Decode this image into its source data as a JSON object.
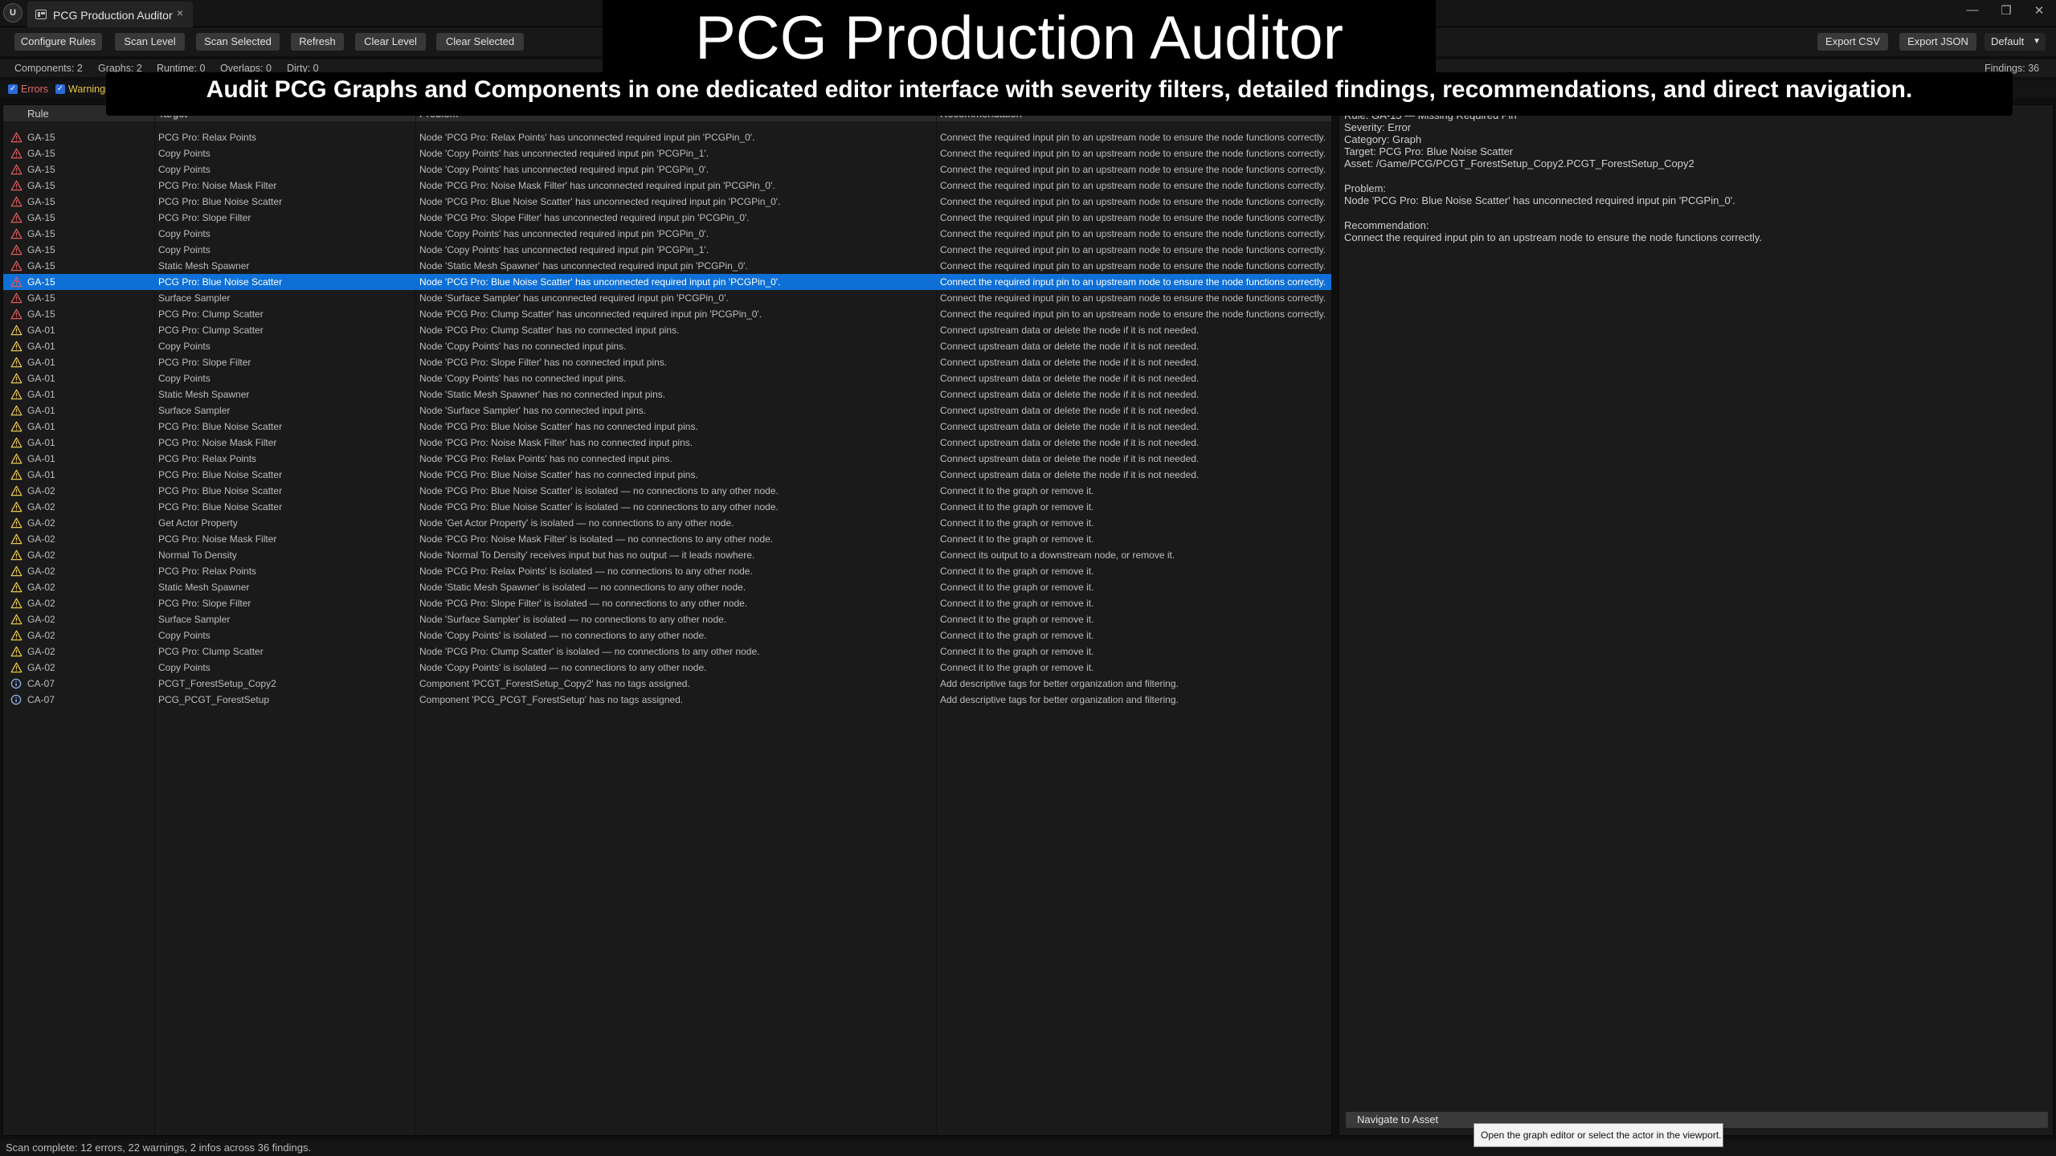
{
  "window": {
    "logo_text": "U",
    "tab_label": "PCG Production Auditor",
    "tab_close": "×",
    "minimize": "—",
    "restore": "❐",
    "close": "✕"
  },
  "toolbar": {
    "buttons": [
      "Configure Rules",
      "Scan Level",
      "Scan Selected",
      "Refresh",
      "Clear Level",
      "Clear Selected"
    ],
    "export_csv": "Export CSV",
    "export_json": "Export JSON",
    "preset": "Default"
  },
  "stats": {
    "components": "Components: 2",
    "graphs": "Graphs: 2",
    "runtime": "Runtime: 0",
    "overlaps": "Overlaps: 0",
    "dirty": "Dirty: 0",
    "findings": "Findings: 36"
  },
  "filters": {
    "errors": "Errors",
    "warnings": "Warnings"
  },
  "table": {
    "headers": [
      "Rule",
      "Target",
      "Problem",
      "Recommendation"
    ],
    "selected_index": 9,
    "rows": [
      {
        "sev": "error",
        "rule": "GA-15",
        "target": "PCG Pro: Relax Points",
        "problem": "Node 'PCG Pro: Relax Points' has unconnected required input pin 'PCGPin_0'.",
        "rec": "Connect the required input pin to an upstream node to ensure the node functions correctly."
      },
      {
        "sev": "error",
        "rule": "GA-15",
        "target": "Copy Points",
        "problem": "Node 'Copy Points' has unconnected required input pin 'PCGPin_1'.",
        "rec": "Connect the required input pin to an upstream node to ensure the node functions correctly."
      },
      {
        "sev": "error",
        "rule": "GA-15",
        "target": "Copy Points",
        "problem": "Node 'Copy Points' has unconnected required input pin 'PCGPin_0'.",
        "rec": "Connect the required input pin to an upstream node to ensure the node functions correctly."
      },
      {
        "sev": "error",
        "rule": "GA-15",
        "target": "PCG Pro: Noise Mask Filter",
        "problem": "Node 'PCG Pro: Noise Mask Filter' has unconnected required input pin 'PCGPin_0'.",
        "rec": "Connect the required input pin to an upstream node to ensure the node functions correctly."
      },
      {
        "sev": "error",
        "rule": "GA-15",
        "target": "PCG Pro: Blue Noise Scatter",
        "problem": "Node 'PCG Pro: Blue Noise Scatter' has unconnected required input pin 'PCGPin_0'.",
        "rec": "Connect the required input pin to an upstream node to ensure the node functions correctly."
      },
      {
        "sev": "error",
        "rule": "GA-15",
        "target": "PCG Pro: Slope Filter",
        "problem": "Node 'PCG Pro: Slope Filter' has unconnected required input pin 'PCGPin_0'.",
        "rec": "Connect the required input pin to an upstream node to ensure the node functions correctly."
      },
      {
        "sev": "error",
        "rule": "GA-15",
        "target": "Copy Points",
        "problem": "Node 'Copy Points' has unconnected required input pin 'PCGPin_0'.",
        "rec": "Connect the required input pin to an upstream node to ensure the node functions correctly."
      },
      {
        "sev": "error",
        "rule": "GA-15",
        "target": "Copy Points",
        "problem": "Node 'Copy Points' has unconnected required input pin 'PCGPin_1'.",
        "rec": "Connect the required input pin to an upstream node to ensure the node functions correctly."
      },
      {
        "sev": "error",
        "rule": "GA-15",
        "target": "Static Mesh Spawner",
        "problem": "Node 'Static Mesh Spawner' has unconnected required input pin 'PCGPin_0'.",
        "rec": "Connect the required input pin to an upstream node to ensure the node functions correctly."
      },
      {
        "sev": "error",
        "rule": "GA-15",
        "target": "PCG Pro: Blue Noise Scatter",
        "problem": "Node 'PCG Pro: Blue Noise Scatter' has unconnected required input pin 'PCGPin_0'.",
        "rec": "Connect the required input pin to an upstream node to ensure the node functions correctly."
      },
      {
        "sev": "error",
        "rule": "GA-15",
        "target": "Surface Sampler",
        "problem": "Node 'Surface Sampler' has unconnected required input pin 'PCGPin_0'.",
        "rec": "Connect the required input pin to an upstream node to ensure the node functions correctly."
      },
      {
        "sev": "error",
        "rule": "GA-15",
        "target": "PCG Pro: Clump Scatter",
        "problem": "Node 'PCG Pro: Clump Scatter' has unconnected required input pin 'PCGPin_0'.",
        "rec": "Connect the required input pin to an upstream node to ensure the node functions correctly."
      },
      {
        "sev": "warning",
        "rule": "GA-01",
        "target": "PCG Pro: Clump Scatter",
        "problem": "Node 'PCG Pro: Clump Scatter' has no connected input pins.",
        "rec": "Connect upstream data or delete the node if it is not needed."
      },
      {
        "sev": "warning",
        "rule": "GA-01",
        "target": "Copy Points",
        "problem": "Node 'Copy Points' has no connected input pins.",
        "rec": "Connect upstream data or delete the node if it is not needed."
      },
      {
        "sev": "warning",
        "rule": "GA-01",
        "target": "PCG Pro: Slope Filter",
        "problem": "Node 'PCG Pro: Slope Filter' has no connected input pins.",
        "rec": "Connect upstream data or delete the node if it is not needed."
      },
      {
        "sev": "warning",
        "rule": "GA-01",
        "target": "Copy Points",
        "problem": "Node 'Copy Points' has no connected input pins.",
        "rec": "Connect upstream data or delete the node if it is not needed."
      },
      {
        "sev": "warning",
        "rule": "GA-01",
        "target": "Static Mesh Spawner",
        "problem": "Node 'Static Mesh Spawner' has no connected input pins.",
        "rec": "Connect upstream data or delete the node if it is not needed."
      },
      {
        "sev": "warning",
        "rule": "GA-01",
        "target": "Surface Sampler",
        "problem": "Node 'Surface Sampler' has no connected input pins.",
        "rec": "Connect upstream data or delete the node if it is not needed."
      },
      {
        "sev": "warning",
        "rule": "GA-01",
        "target": "PCG Pro: Blue Noise Scatter",
        "problem": "Node 'PCG Pro: Blue Noise Scatter' has no connected input pins.",
        "rec": "Connect upstream data or delete the node if it is not needed."
      },
      {
        "sev": "warning",
        "rule": "GA-01",
        "target": "PCG Pro: Noise Mask Filter",
        "problem": "Node 'PCG Pro: Noise Mask Filter' has no connected input pins.",
        "rec": "Connect upstream data or delete the node if it is not needed."
      },
      {
        "sev": "warning",
        "rule": "GA-01",
        "target": "PCG Pro: Relax Points",
        "problem": "Node 'PCG Pro: Relax Points' has no connected input pins.",
        "rec": "Connect upstream data or delete the node if it is not needed."
      },
      {
        "sev": "warning",
        "rule": "GA-01",
        "target": "PCG Pro: Blue Noise Scatter",
        "problem": "Node 'PCG Pro: Blue Noise Scatter' has no connected input pins.",
        "rec": "Connect upstream data or delete the node if it is not needed."
      },
      {
        "sev": "warning",
        "rule": "GA-02",
        "target": "PCG Pro: Blue Noise Scatter",
        "problem": "Node 'PCG Pro: Blue Noise Scatter' is isolated — no connections to any other node.",
        "rec": "Connect it to the graph or remove it."
      },
      {
        "sev": "warning",
        "rule": "GA-02",
        "target": "PCG Pro: Blue Noise Scatter",
        "problem": "Node 'PCG Pro: Blue Noise Scatter' is isolated — no connections to any other node.",
        "rec": "Connect it to the graph or remove it."
      },
      {
        "sev": "warning",
        "rule": "GA-02",
        "target": "Get Actor Property",
        "problem": "Node 'Get Actor Property' is isolated — no connections to any other node.",
        "rec": "Connect it to the graph or remove it."
      },
      {
        "sev": "warning",
        "rule": "GA-02",
        "target": "PCG Pro: Noise Mask Filter",
        "problem": "Node 'PCG Pro: Noise Mask Filter' is isolated — no connections to any other node.",
        "rec": "Connect it to the graph or remove it."
      },
      {
        "sev": "warning",
        "rule": "GA-02",
        "target": "Normal To Density",
        "problem": "Node 'Normal To Density' receives input but has no output — it leads nowhere.",
        "rec": "Connect its output to a downstream node, or remove it."
      },
      {
        "sev": "warning",
        "rule": "GA-02",
        "target": "PCG Pro: Relax Points",
        "problem": "Node 'PCG Pro: Relax Points' is isolated — no connections to any other node.",
        "rec": "Connect it to the graph or remove it."
      },
      {
        "sev": "warning",
        "rule": "GA-02",
        "target": "Static Mesh Spawner",
        "problem": "Node 'Static Mesh Spawner' is isolated — no connections to any other node.",
        "rec": "Connect it to the graph or remove it."
      },
      {
        "sev": "warning",
        "rule": "GA-02",
        "target": "PCG Pro: Slope Filter",
        "problem": "Node 'PCG Pro: Slope Filter' is isolated — no connections to any other node.",
        "rec": "Connect it to the graph or remove it."
      },
      {
        "sev": "warning",
        "rule": "GA-02",
        "target": "Surface Sampler",
        "problem": "Node 'Surface Sampler' is isolated — no connections to any other node.",
        "rec": "Connect it to the graph or remove it."
      },
      {
        "sev": "warning",
        "rule": "GA-02",
        "target": "Copy Points",
        "problem": "Node 'Copy Points' is isolated — no connections to any other node.",
        "rec": "Connect it to the graph or remove it."
      },
      {
        "sev": "warning",
        "rule": "GA-02",
        "target": "PCG Pro: Clump Scatter",
        "problem": "Node 'PCG Pro: Clump Scatter' is isolated — no connections to any other node.",
        "rec": "Connect it to the graph or remove it."
      },
      {
        "sev": "warning",
        "rule": "GA-02",
        "target": "Copy Points",
        "problem": "Node 'Copy Points' is isolated — no connections to any other node.",
        "rec": "Connect it to the graph or remove it."
      },
      {
        "sev": "info",
        "rule": "CA-07",
        "target": "PCGT_ForestSetup_Copy2",
        "problem": "Component 'PCGT_ForestSetup_Copy2' has no tags assigned.",
        "rec": "Add descriptive tags for better organization and filtering."
      },
      {
        "sev": "info",
        "rule": "CA-07",
        "target": "PCG_PCGT_ForestSetup",
        "problem": "Component 'PCG_PCGT_ForestSetup' has no tags assigned.",
        "rec": "Add descriptive tags for better organization and filtering."
      }
    ]
  },
  "details": {
    "rule": "Rule: GA-15 — Missing Required Pin",
    "severity": "Severity: Error",
    "category": "Category: Graph",
    "target": "Target: PCG Pro: Blue Noise Scatter",
    "asset": "Asset: /Game/PCG/PCGT_ForestSetup_Copy2.PCGT_ForestSetup_Copy2",
    "problem_label": "Problem:",
    "problem": "Node 'PCG Pro: Blue Noise Scatter' has unconnected required input pin 'PCGPin_0'.",
    "recommendation_label": "Recommendation:",
    "recommendation": "Connect the required input pin to an upstream node to ensure the node functions correctly.",
    "navigate_button": "Navigate to Asset",
    "tooltip": "Open the graph editor or select the actor in the viewport."
  },
  "status": "Scan complete: 12 errors, 22 warnings, 2 infos across 36 findings.",
  "promo": {
    "title": "PCG Production Auditor",
    "subtitle": "Audit PCG Graphs and Components in one dedicated editor interface with severity filters, detailed findings, recommendations, and direct navigation."
  },
  "colors": {
    "error": "#e25a5a",
    "warning": "#e8c64a",
    "info": "#8fb6e8",
    "selected": "#0e70d6"
  }
}
